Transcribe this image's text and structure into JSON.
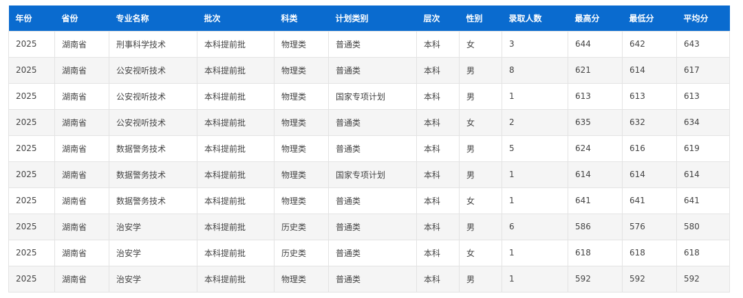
{
  "table": {
    "headers": [
      "年份",
      "省份",
      "专业名称",
      "批次",
      "科类",
      "计划类别",
      "层次",
      "性别",
      "录取人数",
      "最高分",
      "最低分",
      "平均分"
    ],
    "rows": [
      [
        "2025",
        "湖南省",
        "刑事科学技术",
        "本科提前批",
        "物理类",
        "普通类",
        "本科",
        "女",
        "3",
        "644",
        "642",
        "643"
      ],
      [
        "2025",
        "湖南省",
        "公安视听技术",
        "本科提前批",
        "物理类",
        "普通类",
        "本科",
        "男",
        "8",
        "621",
        "614",
        "617"
      ],
      [
        "2025",
        "湖南省",
        "公安视听技术",
        "本科提前批",
        "物理类",
        "国家专项计划",
        "本科",
        "男",
        "1",
        "613",
        "613",
        "613"
      ],
      [
        "2025",
        "湖南省",
        "公安视听技术",
        "本科提前批",
        "物理类",
        "普通类",
        "本科",
        "女",
        "2",
        "635",
        "632",
        "634"
      ],
      [
        "2025",
        "湖南省",
        "数据警务技术",
        "本科提前批",
        "物理类",
        "普通类",
        "本科",
        "男",
        "5",
        "624",
        "616",
        "619"
      ],
      [
        "2025",
        "湖南省",
        "数据警务技术",
        "本科提前批",
        "物理类",
        "国家专项计划",
        "本科",
        "男",
        "1",
        "614",
        "614",
        "614"
      ],
      [
        "2025",
        "湖南省",
        "数据警务技术",
        "本科提前批",
        "物理类",
        "普通类",
        "本科",
        "女",
        "1",
        "641",
        "641",
        "641"
      ],
      [
        "2025",
        "湖南省",
        "治安学",
        "本科提前批",
        "历史类",
        "普通类",
        "本科",
        "男",
        "6",
        "586",
        "576",
        "580"
      ],
      [
        "2025",
        "湖南省",
        "治安学",
        "本科提前批",
        "历史类",
        "普通类",
        "本科",
        "女",
        "1",
        "618",
        "618",
        "618"
      ],
      [
        "2025",
        "湖南省",
        "治安学",
        "本科提前批",
        "物理类",
        "普通类",
        "本科",
        "男",
        "1",
        "592",
        "592",
        "592"
      ]
    ]
  },
  "colors": {
    "header_bg": "#0a6bcf",
    "header_text": "#ffffff",
    "row_alt": "#f5f5f5",
    "border": "#e3e3e3"
  }
}
